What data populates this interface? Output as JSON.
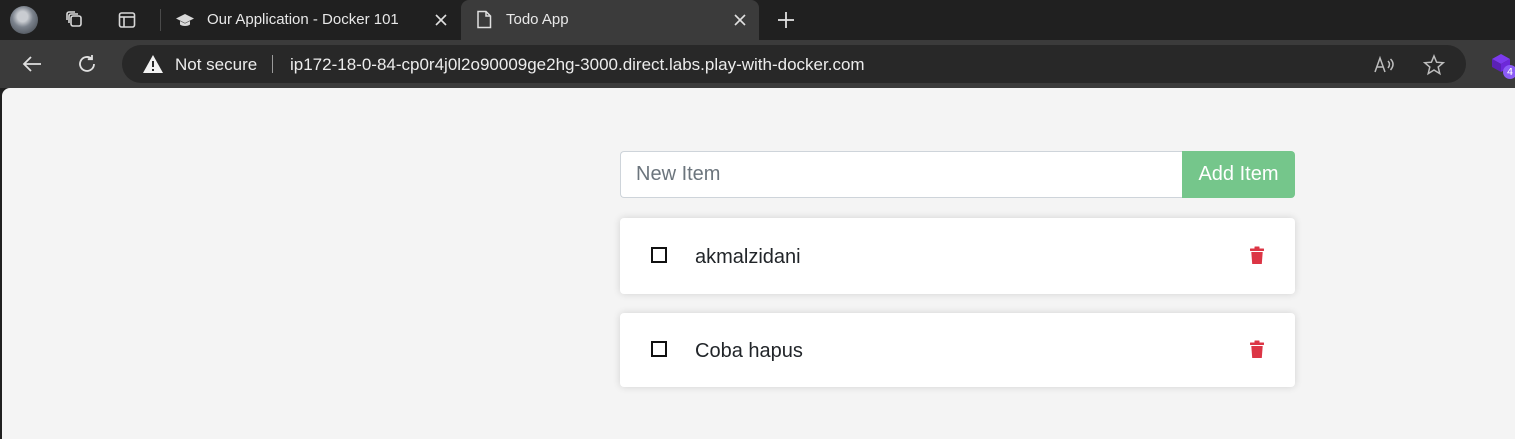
{
  "browser": {
    "tabs": [
      {
        "title": "Our Application - Docker 101",
        "icon": "graduation-cap-icon",
        "active": false
      },
      {
        "title": "Todo App",
        "icon": "page-icon",
        "active": true
      }
    ],
    "address_bar": {
      "security_label": "Not secure",
      "url": "ip172-18-0-84-cp0r4j0l2o90009ge2hg-3000.direct.labs.play-with-docker.com"
    },
    "extension_badge": "4"
  },
  "app": {
    "new_item": {
      "placeholder": "New Item",
      "value": ""
    },
    "add_button_label": "Add Item",
    "items": [
      {
        "name": "akmalzidani",
        "completed": false
      },
      {
        "name": "Coba hapus",
        "completed": false
      }
    ]
  },
  "colors": {
    "add_button": "#75c68b",
    "delete_icon": "#dc3545",
    "page_background": "#f4f4f4",
    "browser_frame": "#202020"
  }
}
